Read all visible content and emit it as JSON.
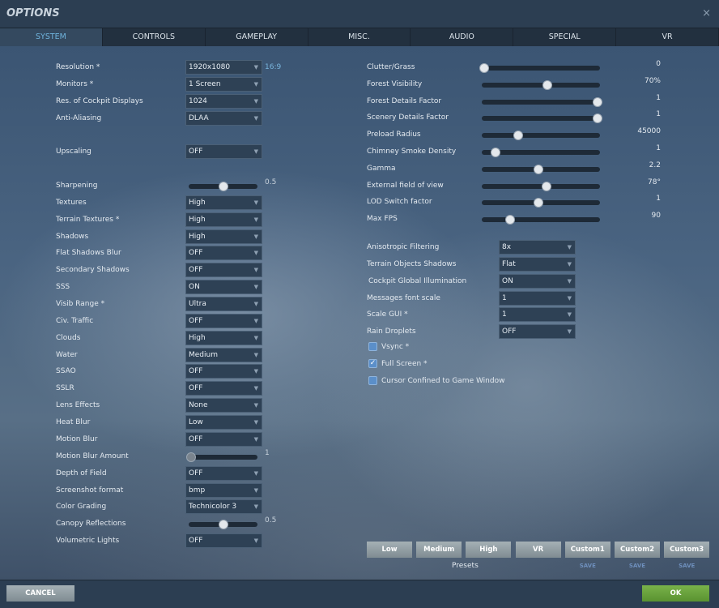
{
  "window": {
    "title": "OPTIONS",
    "close_icon": "×"
  },
  "tabs": [
    "SYSTEM",
    "CONTROLS",
    "GAMEPLAY",
    "MISC.",
    "AUDIO",
    "SPECIAL",
    "VR"
  ],
  "left": [
    {
      "label": "Resolution *",
      "type": "dropdown",
      "value": "1920x1080",
      "extra": "16:9",
      "row": 0
    },
    {
      "label": "Monitors *",
      "type": "dropdown",
      "value": "1 Screen",
      "row": 1
    },
    {
      "label": "Res. of Cockpit Displays",
      "type": "dropdown",
      "value": "1024",
      "row": 2
    },
    {
      "label": "Anti-Aliasing",
      "type": "dropdown",
      "value": "DLAA",
      "row": 3
    },
    {
      "label": "Upscaling",
      "type": "dropdown",
      "value": "OFF",
      "row": 5
    },
    {
      "label": "Sharpening",
      "type": "slider",
      "value": "0.5",
      "fraction": 0.5,
      "row": 7
    },
    {
      "label": "Textures",
      "type": "dropdown",
      "value": "High",
      "row": 8
    },
    {
      "label": "Terrain Textures *",
      "type": "dropdown",
      "value": "High",
      "row": 9
    },
    {
      "label": "Shadows",
      "type": "dropdown",
      "value": "High",
      "row": 10
    },
    {
      "label": "Flat Shadows Blur",
      "type": "dropdown",
      "value": "OFF",
      "row": 11
    },
    {
      "label": "Secondary Shadows",
      "type": "dropdown",
      "value": "OFF",
      "row": 12
    },
    {
      "label": "SSS",
      "type": "dropdown",
      "value": "ON",
      "row": 13
    },
    {
      "label": "Visib Range *",
      "type": "dropdown",
      "value": "Ultra",
      "row": 14
    },
    {
      "label": "Civ. Traffic",
      "type": "dropdown",
      "value": "OFF",
      "row": 15
    },
    {
      "label": "Clouds",
      "type": "dropdown",
      "value": "High",
      "row": 16
    },
    {
      "label": "Water",
      "type": "dropdown",
      "value": "Medium",
      "row": 17
    },
    {
      "label": "SSAO",
      "type": "dropdown",
      "value": "OFF",
      "row": 18
    },
    {
      "label": "SSLR",
      "type": "dropdown",
      "value": "OFF",
      "row": 19
    },
    {
      "label": "Lens Effects",
      "type": "dropdown",
      "value": "None",
      "row": 20
    },
    {
      "label": "Heat Blur",
      "type": "dropdown",
      "value": "Low",
      "row": 21
    },
    {
      "label": "Motion Blur",
      "type": "dropdown",
      "value": "OFF",
      "row": 22
    },
    {
      "label": "Motion Blur Amount",
      "type": "slider",
      "value": "1",
      "fraction": 0,
      "disabled": true,
      "row": 23
    },
    {
      "label": "Depth of Field",
      "type": "dropdown",
      "value": "OFF",
      "row": 24
    },
    {
      "label": "Screenshot format",
      "type": "dropdown",
      "value": "bmp",
      "row": 25
    },
    {
      "label": "Color Grading",
      "type": "dropdown",
      "value": "Technicolor 3",
      "row": 26
    },
    {
      "label": "Canopy Reflections",
      "type": "slider",
      "value": "0.5",
      "fraction": 0.5,
      "row": 27
    },
    {
      "label": "Volumetric Lights",
      "type": "dropdown",
      "value": "OFF",
      "row": 28
    }
  ],
  "right_sliders": [
    {
      "label": "Clutter/Grass",
      "value": "0",
      "fraction": 0.0
    },
    {
      "label": "Forest Visibility",
      "value": "70%",
      "fraction": 0.56
    },
    {
      "label": "Forest Details Factor",
      "value": "1",
      "fraction": 1.0
    },
    {
      "label": "Scenery Details Factor",
      "value": "1",
      "fraction": 1.0
    },
    {
      "label": "Preload Radius",
      "value": "45000",
      "fraction": 0.3
    },
    {
      "label": "Chimney Smoke Density",
      "value": "1",
      "fraction": 0.1
    },
    {
      "label": "Gamma",
      "value": "2.2",
      "fraction": 0.48
    },
    {
      "label": "External field of view",
      "value": "78°",
      "fraction": 0.55
    },
    {
      "label": "LOD Switch factor",
      "value": "1",
      "fraction": 0.48
    },
    {
      "label": "Max FPS",
      "value": "90",
      "fraction": 0.23
    }
  ],
  "right_dropdowns": [
    {
      "label": "Anisotropic Filtering",
      "value": "8x"
    },
    {
      "label": "Terrain Objects Shadows",
      "value": "Flat"
    },
    {
      "label": "Cockpit Global Illumination",
      "value": "ON"
    },
    {
      "label": "Messages font scale",
      "value": "1"
    },
    {
      "label": "Scale GUI *",
      "value": "1"
    },
    {
      "label": "Rain Droplets",
      "value": "OFF"
    }
  ],
  "checkboxes": [
    {
      "label": "Vsync *",
      "checked": false
    },
    {
      "label": "Full Screen *",
      "checked": true
    },
    {
      "label": "Cursor Confined to Game Window",
      "checked": false
    }
  ],
  "presets": {
    "buttons": [
      "Low",
      "Medium",
      "High",
      "VR",
      "Custom1",
      "Custom2",
      "Custom3"
    ],
    "label": "Presets",
    "save": "SAVE"
  },
  "footer": {
    "cancel": "CANCEL",
    "ok": "OK"
  },
  "colors": {
    "accent": "#6fb3dc",
    "ok": "#6aa23c"
  }
}
